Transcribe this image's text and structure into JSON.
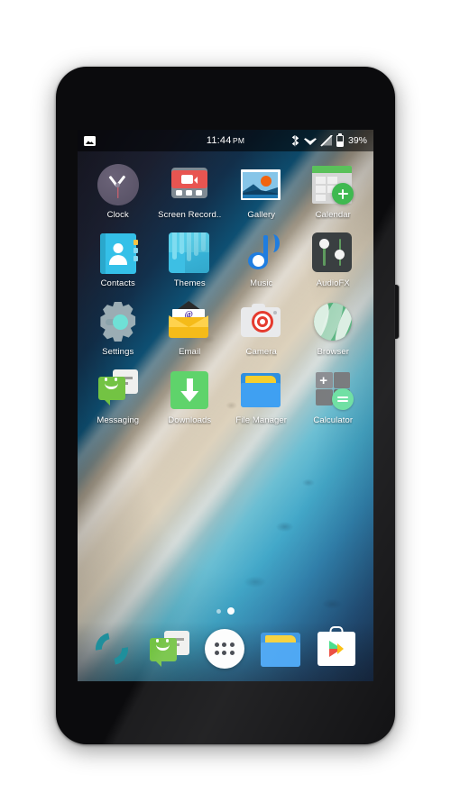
{
  "device": {
    "name": "smartphone-mockup"
  },
  "statusbar": {
    "left_icon": "gallery-notification-icon",
    "time": "11:44",
    "ampm": "PM",
    "icons": [
      "bluetooth-icon",
      "wifi-icon",
      "signal-icon",
      "battery-icon"
    ],
    "battery_percent": "39%"
  },
  "homescreen": {
    "rows": [
      [
        {
          "label": "Clock",
          "icon": "clock-icon"
        },
        {
          "label": "Screen Record..",
          "icon": "screen-record-icon"
        },
        {
          "label": "Gallery",
          "icon": "gallery-icon"
        },
        {
          "label": "Calendar",
          "icon": "calendar-icon"
        }
      ],
      [
        {
          "label": "Contacts",
          "icon": "contacts-icon"
        },
        {
          "label": "Themes",
          "icon": "themes-icon"
        },
        {
          "label": "Music",
          "icon": "music-icon"
        },
        {
          "label": "AudioFX",
          "icon": "audiofx-icon"
        }
      ],
      [
        {
          "label": "Settings",
          "icon": "settings-icon"
        },
        {
          "label": "Email",
          "icon": "email-icon"
        },
        {
          "label": "Camera",
          "icon": "camera-icon"
        },
        {
          "label": "Browser",
          "icon": "browser-icon"
        }
      ],
      [
        {
          "label": "Messaging",
          "icon": "messaging-icon"
        },
        {
          "label": "Downloads",
          "icon": "downloads-icon"
        },
        {
          "label": "File Manager",
          "icon": "file-manager-icon"
        },
        {
          "label": "Calculator",
          "icon": "calculator-icon"
        }
      ]
    ],
    "page_indicator": {
      "total": 2,
      "active": 2
    },
    "dock": [
      {
        "name": "Phone",
        "icon": "phone-icon"
      },
      {
        "name": "Messaging",
        "icon": "messaging-icon"
      },
      {
        "name": "All Apps",
        "icon": "app-drawer-icon"
      },
      {
        "name": "File Manager",
        "icon": "file-manager-icon"
      },
      {
        "name": "Play Store",
        "icon": "play-store-icon"
      }
    ]
  },
  "colors": {
    "accent_green": "#5fd36b",
    "accent_blue": "#2f8fe0",
    "accent_red": "#e53b2f",
    "bezel": "#0b0b0d"
  }
}
